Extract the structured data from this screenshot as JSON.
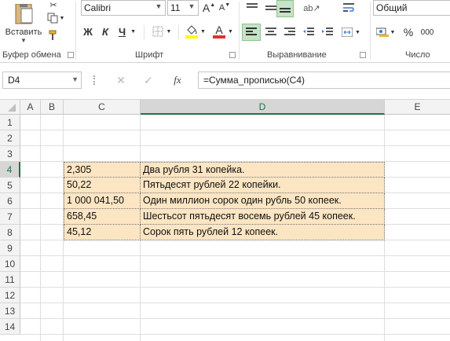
{
  "ribbon": {
    "clipboard": {
      "paste_label": "Вставить",
      "group_label": "Буфер обмена"
    },
    "font": {
      "font_name": "Calibri",
      "font_size": "11",
      "bold_label": "Ж",
      "italic_label": "К",
      "underline_label": "Ч",
      "grow_label": "A",
      "shrink_label": "A",
      "font_color_label": "A",
      "group_label": "Шрифт",
      "fill_color": "#ffff00",
      "font_color": "#e03030"
    },
    "alignment": {
      "group_label": "Выравнивание"
    },
    "number": {
      "format": "Общий",
      "percent_label": "%",
      "thousands_label": "000",
      "group_label": "Число"
    }
  },
  "formula_bar": {
    "name_box": "D4",
    "fx_label": "fx",
    "formula": "=Сумма_прописью(C4)"
  },
  "sheet": {
    "columns": [
      "A",
      "B",
      "C",
      "D",
      "E"
    ],
    "rows": [
      "1",
      "2",
      "3",
      "4",
      "5",
      "6",
      "7",
      "8",
      "9",
      "10",
      "11",
      "12",
      "13",
      "14"
    ],
    "data_rows": [
      {
        "c": "2,305",
        "d": "Два  рубля 31 копейка."
      },
      {
        "c": "50,22",
        "d": "Пятьдесят рублей 22 копейки."
      },
      {
        "c": "1 000 041,50",
        "d": "Один миллион сорок один рубль 50 копеек."
      },
      {
        "c": "658,45",
        "d": "Шестьсот пятьдесят восемь рублей 45 копеек."
      },
      {
        "c": "45,12",
        "d": "Сорок пять рублей 12 копеек."
      }
    ],
    "highlight_color": "#fbe5c3"
  }
}
